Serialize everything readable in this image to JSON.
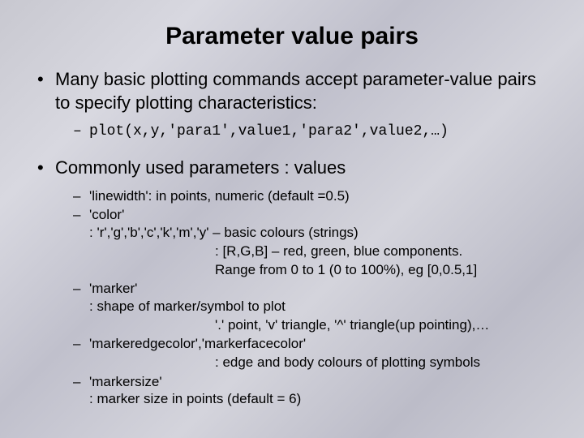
{
  "title": "Parameter value pairs",
  "intro": "Many basic plotting commands accept parameter-value pairs to specify plotting characteristics:",
  "plotexample": "plot(x,y,'para1',value1,'para2',value2,…)",
  "section2": "Commonly used parameters : values",
  "p_linewidth": "'linewidth': in points, numeric (default =0.5)",
  "p_color_name": "'color'",
  "p_color_v1": ": 'r','g','b','c','k','m','y' – basic colours (strings)",
  "p_color_v2": ": [R,G,B] – red, green, blue components.",
  "p_color_v3": "  Range from 0 to 1 (0 to 100%), eg [0,0.5,1]",
  "p_marker_name": "'marker'",
  "p_marker_v1": ": shape of marker/symbol to plot",
  "p_marker_v2": "  '.' point, 'v' triangle, '^' triangle(up pointing),…",
  "p_mec": "'markeredgecolor','markerfacecolor'",
  "p_mec_v": ": edge and body colours of plotting symbols",
  "p_msize_name": "'markersize'",
  "p_msize_v": ": marker size in points (default = 6)"
}
